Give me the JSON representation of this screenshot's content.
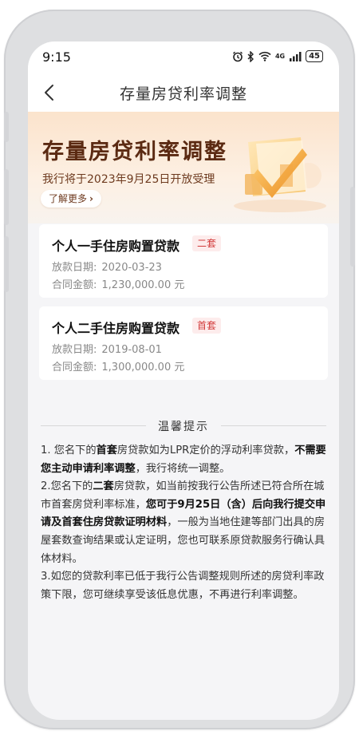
{
  "status": {
    "time": "9:15",
    "icons": [
      "alarm-icon",
      "bluetooth-icon",
      "wifi-icon",
      "signal-icon"
    ],
    "signal_label": "4G",
    "battery": "45"
  },
  "nav": {
    "title": "存量房贷利率调整"
  },
  "banner": {
    "title": "存量房贷利率调整",
    "subtitle": "我行将于2023年9月25日开放受理",
    "more_label": "了解更多",
    "more_chevron": "›"
  },
  "loans": [
    {
      "title": "个人一手住房购置贷款",
      "tag": "二套",
      "date_label": "放款日期:",
      "date": "2020-03-23",
      "amount_label": "合同金额:",
      "amount": "1,230,000.00 元"
    },
    {
      "title": "个人二手住房购置贷款",
      "tag": "首套",
      "date_label": "放款日期:",
      "date": "2019-08-01",
      "amount_label": "合同金额:",
      "amount": "1,300,000.00 元"
    }
  ],
  "tips": {
    "title": "温馨提示",
    "p1": {
      "a": "1. 您名下的",
      "b": "首套",
      "c": "房贷款如为LPR定价的浮动利率贷款，",
      "d": "不需要您主动申请利率调整",
      "e": "，我行将统一调整。"
    },
    "p2": {
      "a": "2.您名下的",
      "b": "二套",
      "c": "房贷款，如当前按我行公告所述已符合所在城市首套房贷利率标准，",
      "d": "您可于9月25日（含）后向我行提交申请及首套住房贷款证明材料",
      "e": "，一般为当地住建等部门出具的房屋套数查询结果或认定证明，您也可联系原贷款服务行确认具体材料。"
    },
    "p3": "3.如您的贷款利率已低于我行公告调整规则所述的房贷利率政策下限，您可继续享受该低息优惠，不再进行利率调整。"
  },
  "colors": {
    "banner_title": "#5b2a12",
    "tag_text": "#d23b3b",
    "tag_bg": "#fdecec",
    "page_bg": "#f5f5f7"
  }
}
